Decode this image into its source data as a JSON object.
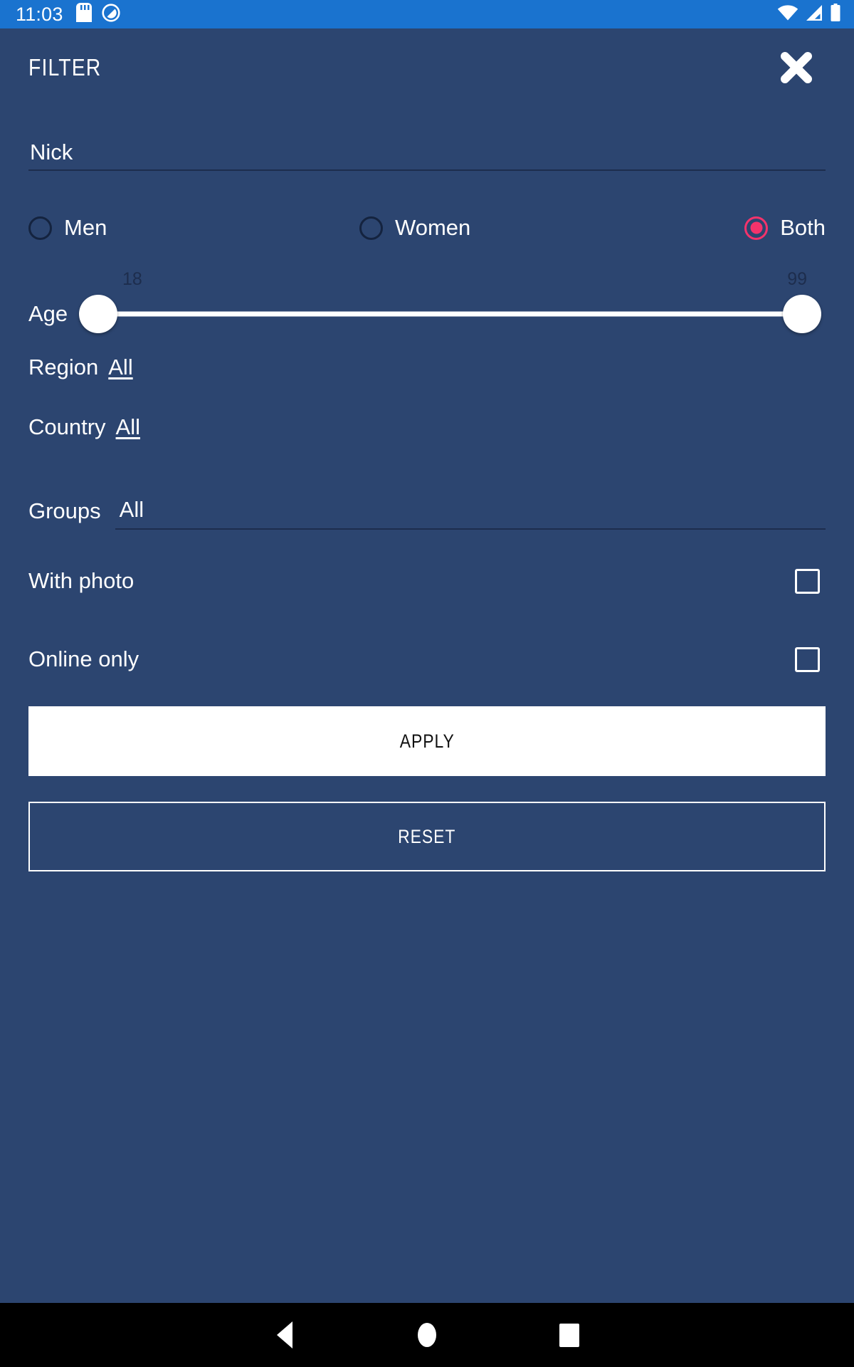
{
  "status_bar": {
    "time": "11:03",
    "left_icons": [
      "sd-card-icon",
      "app-notification-icon"
    ],
    "right_icons": [
      "wifi-icon",
      "cell-signal-icon",
      "battery-icon"
    ],
    "background_color": "#1a73cf"
  },
  "panel": {
    "title": "FILTER",
    "close_label": "close-icon",
    "background_color": "#2c4570"
  },
  "nick": {
    "value": "",
    "placeholder": "Nick"
  },
  "gender": {
    "options": [
      {
        "label": "Men",
        "selected": false
      },
      {
        "label": "Women",
        "selected": false
      },
      {
        "label": "Both",
        "selected": true
      }
    ],
    "selected_color": "#f5336b"
  },
  "age": {
    "label": "Age",
    "min": "18",
    "max": "99"
  },
  "region": {
    "label": "Region",
    "value": "All"
  },
  "country": {
    "label": "Country",
    "value": "All"
  },
  "groups": {
    "label": "Groups",
    "value": "All"
  },
  "toggles": [
    {
      "label": "With photo",
      "checked": false
    },
    {
      "label": "Online only",
      "checked": false
    }
  ],
  "buttons": {
    "apply": "APPLY",
    "reset": "RESET"
  },
  "nav_bar": {
    "back": "back-icon",
    "home": "home-icon",
    "recents": "recents-icon"
  }
}
